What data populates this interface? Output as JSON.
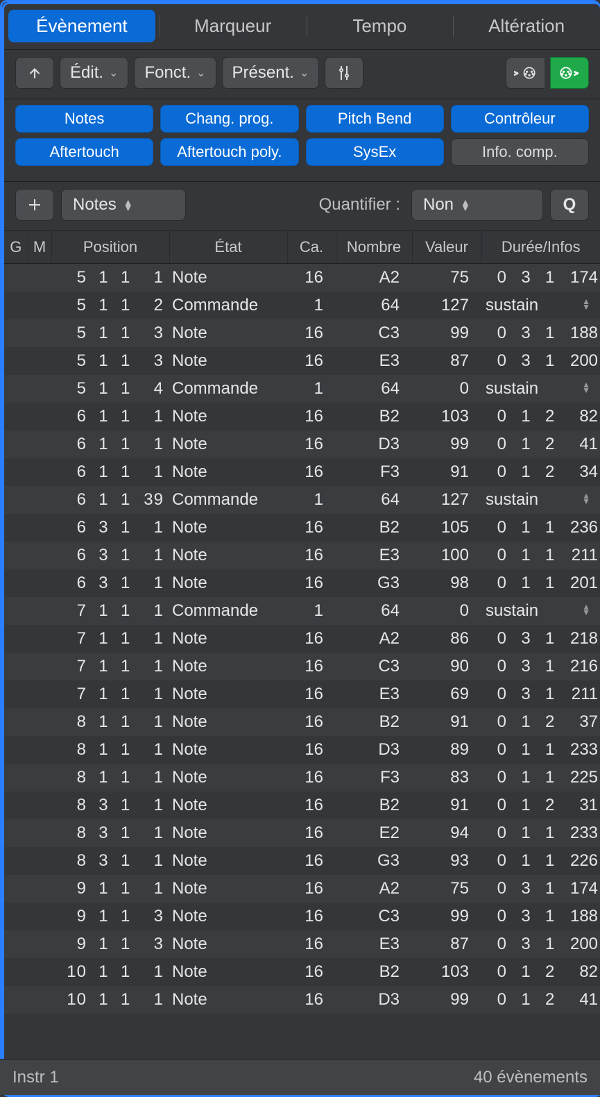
{
  "tabs": {
    "event": "Évènement",
    "marker": "Marqueur",
    "tempo": "Tempo",
    "alter": "Altération"
  },
  "toolbar": {
    "edit": "Édit.",
    "funct": "Fonct.",
    "present": "Présent."
  },
  "filters": {
    "notes": "Notes",
    "progchange": "Chang. prog.",
    "pitchbend": "Pitch Bend",
    "controller": "Contrôleur",
    "aftertouch": "Aftertouch",
    "polyafter": "Aftertouch poly.",
    "sysex": "SysEx",
    "info": "Info. comp."
  },
  "addrow": {
    "type": "Notes",
    "quantize_label": "Quantifier :",
    "quantize_value": "Non",
    "q": "Q"
  },
  "columns": {
    "g": "G",
    "m": "M",
    "pos": "Position",
    "etat": "État",
    "ca": "Ca.",
    "num": "Nombre",
    "val": "Valeur",
    "dur": "Durée/Infos"
  },
  "status": {
    "left": "Instr 1",
    "right": "40 évènements"
  },
  "sustain_label": "sustain",
  "rows": [
    {
      "pos": [
        5,
        1,
        1,
        1
      ],
      "etat": "Note",
      "ca": 16,
      "num": "A2",
      "val": 75,
      "dur": [
        0,
        3,
        1,
        174
      ]
    },
    {
      "pos": [
        5,
        1,
        1,
        2
      ],
      "etat": "Commande",
      "ca": 1,
      "num": "64",
      "val": 127,
      "dur": "sustain"
    },
    {
      "pos": [
        5,
        1,
        1,
        3
      ],
      "etat": "Note",
      "ca": 16,
      "num": "C3",
      "val": 99,
      "dur": [
        0,
        3,
        1,
        188
      ]
    },
    {
      "pos": [
        5,
        1,
        1,
        3
      ],
      "etat": "Note",
      "ca": 16,
      "num": "E3",
      "val": 87,
      "dur": [
        0,
        3,
        1,
        200
      ]
    },
    {
      "pos": [
        5,
        1,
        1,
        4
      ],
      "etat": "Commande",
      "ca": 1,
      "num": "64",
      "val": 0,
      "dur": "sustain"
    },
    {
      "pos": [
        6,
        1,
        1,
        1
      ],
      "etat": "Note",
      "ca": 16,
      "num": "B2",
      "val": 103,
      "dur": [
        0,
        1,
        2,
        82
      ]
    },
    {
      "pos": [
        6,
        1,
        1,
        1
      ],
      "etat": "Note",
      "ca": 16,
      "num": "D3",
      "val": 99,
      "dur": [
        0,
        1,
        2,
        41
      ]
    },
    {
      "pos": [
        6,
        1,
        1,
        1
      ],
      "etat": "Note",
      "ca": 16,
      "num": "F3",
      "val": 91,
      "dur": [
        0,
        1,
        2,
        34
      ]
    },
    {
      "pos": [
        6,
        1,
        1,
        39
      ],
      "etat": "Commande",
      "ca": 1,
      "num": "64",
      "val": 127,
      "dur": "sustain"
    },
    {
      "pos": [
        6,
        3,
        1,
        1
      ],
      "etat": "Note",
      "ca": 16,
      "num": "B2",
      "val": 105,
      "dur": [
        0,
        1,
        1,
        236
      ]
    },
    {
      "pos": [
        6,
        3,
        1,
        1
      ],
      "etat": "Note",
      "ca": 16,
      "num": "E3",
      "val": 100,
      "dur": [
        0,
        1,
        1,
        211
      ]
    },
    {
      "pos": [
        6,
        3,
        1,
        1
      ],
      "etat": "Note",
      "ca": 16,
      "num": "G3",
      "val": 98,
      "dur": [
        0,
        1,
        1,
        201
      ]
    },
    {
      "pos": [
        7,
        1,
        1,
        1
      ],
      "etat": "Commande",
      "ca": 1,
      "num": "64",
      "val": 0,
      "dur": "sustain"
    },
    {
      "pos": [
        7,
        1,
        1,
        1
      ],
      "etat": "Note",
      "ca": 16,
      "num": "A2",
      "val": 86,
      "dur": [
        0,
        3,
        1,
        218
      ]
    },
    {
      "pos": [
        7,
        1,
        1,
        1
      ],
      "etat": "Note",
      "ca": 16,
      "num": "C3",
      "val": 90,
      "dur": [
        0,
        3,
        1,
        216
      ]
    },
    {
      "pos": [
        7,
        1,
        1,
        1
      ],
      "etat": "Note",
      "ca": 16,
      "num": "E3",
      "val": 69,
      "dur": [
        0,
        3,
        1,
        211
      ]
    },
    {
      "pos": [
        8,
        1,
        1,
        1
      ],
      "etat": "Note",
      "ca": 16,
      "num": "B2",
      "val": 91,
      "dur": [
        0,
        1,
        2,
        37
      ]
    },
    {
      "pos": [
        8,
        1,
        1,
        1
      ],
      "etat": "Note",
      "ca": 16,
      "num": "D3",
      "val": 89,
      "dur": [
        0,
        1,
        1,
        233
      ]
    },
    {
      "pos": [
        8,
        1,
        1,
        1
      ],
      "etat": "Note",
      "ca": 16,
      "num": "F3",
      "val": 83,
      "dur": [
        0,
        1,
        1,
        225
      ]
    },
    {
      "pos": [
        8,
        3,
        1,
        1
      ],
      "etat": "Note",
      "ca": 16,
      "num": "B2",
      "val": 91,
      "dur": [
        0,
        1,
        2,
        31
      ]
    },
    {
      "pos": [
        8,
        3,
        1,
        1
      ],
      "etat": "Note",
      "ca": 16,
      "num": "E2",
      "val": 94,
      "dur": [
        0,
        1,
        1,
        233
      ]
    },
    {
      "pos": [
        8,
        3,
        1,
        1
      ],
      "etat": "Note",
      "ca": 16,
      "num": "G3",
      "val": 93,
      "dur": [
        0,
        1,
        1,
        226
      ]
    },
    {
      "pos": [
        9,
        1,
        1,
        1
      ],
      "etat": "Note",
      "ca": 16,
      "num": "A2",
      "val": 75,
      "dur": [
        0,
        3,
        1,
        174
      ]
    },
    {
      "pos": [
        9,
        1,
        1,
        3
      ],
      "etat": "Note",
      "ca": 16,
      "num": "C3",
      "val": 99,
      "dur": [
        0,
        3,
        1,
        188
      ]
    },
    {
      "pos": [
        9,
        1,
        1,
        3
      ],
      "etat": "Note",
      "ca": 16,
      "num": "E3",
      "val": 87,
      "dur": [
        0,
        3,
        1,
        200
      ]
    },
    {
      "pos": [
        10,
        1,
        1,
        1
      ],
      "etat": "Note",
      "ca": 16,
      "num": "B2",
      "val": 103,
      "dur": [
        0,
        1,
        2,
        82
      ]
    },
    {
      "pos": [
        10,
        1,
        1,
        1
      ],
      "etat": "Note",
      "ca": 16,
      "num": "D3",
      "val": 99,
      "dur": [
        0,
        1,
        2,
        41
      ]
    }
  ]
}
